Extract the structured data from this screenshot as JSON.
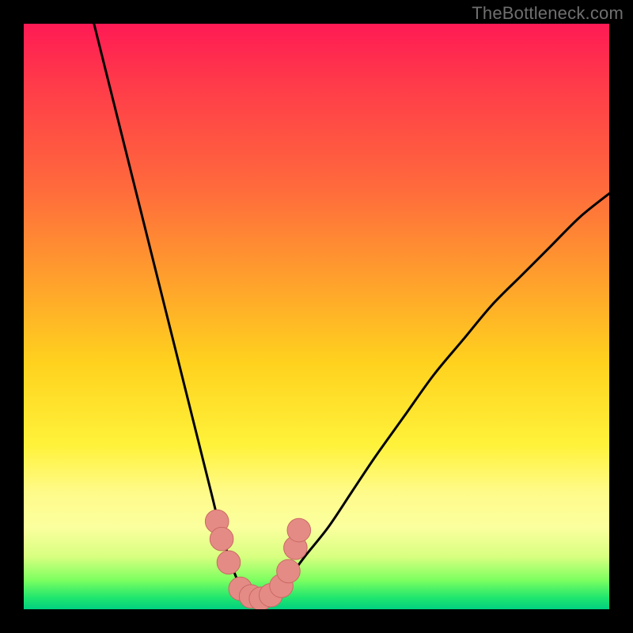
{
  "watermark": "TheBottleneck.com",
  "colors": {
    "curve": "#000000",
    "marker_fill": "#e58b86",
    "marker_stroke": "#c96a64",
    "frame": "#000000"
  },
  "chart_data": {
    "type": "line",
    "title": "",
    "xlabel": "",
    "ylabel": "",
    "xlim": [
      0,
      100
    ],
    "ylim": [
      0,
      100
    ],
    "grid": false,
    "legend": false,
    "series": [
      {
        "name": "left-branch",
        "x": [
          12,
          14,
          16,
          18,
          20,
          22,
          24,
          26,
          28,
          30,
          32,
          33.5,
          35,
          36.5,
          38
        ],
        "y": [
          100,
          92,
          84,
          76,
          68,
          60,
          52,
          44,
          36,
          28,
          20,
          14,
          9,
          5,
          3
        ]
      },
      {
        "name": "right-branch",
        "x": [
          43,
          45,
          48,
          52,
          56,
          60,
          65,
          70,
          75,
          80,
          85,
          90,
          95,
          100
        ],
        "y": [
          3,
          5,
          9,
          14,
          20,
          26,
          33,
          40,
          46,
          52,
          57,
          62,
          67,
          71
        ]
      },
      {
        "name": "valley-floor",
        "x": [
          38,
          39,
          40,
          41,
          42,
          43
        ],
        "y": [
          3,
          2,
          1.6,
          1.6,
          2,
          3
        ]
      }
    ],
    "markers": {
      "name": "valley-markers",
      "points": [
        {
          "x": 33.0,
          "y": 15
        },
        {
          "x": 33.8,
          "y": 12
        },
        {
          "x": 35.0,
          "y": 8
        },
        {
          "x": 37.0,
          "y": 3.5
        },
        {
          "x": 38.8,
          "y": 2.2
        },
        {
          "x": 40.5,
          "y": 1.8
        },
        {
          "x": 42.2,
          "y": 2.4
        },
        {
          "x": 44.0,
          "y": 4.0
        },
        {
          "x": 45.2,
          "y": 6.5
        },
        {
          "x": 46.4,
          "y": 10.5
        },
        {
          "x": 47.0,
          "y": 13.5
        }
      ],
      "radius": 2.0
    }
  }
}
